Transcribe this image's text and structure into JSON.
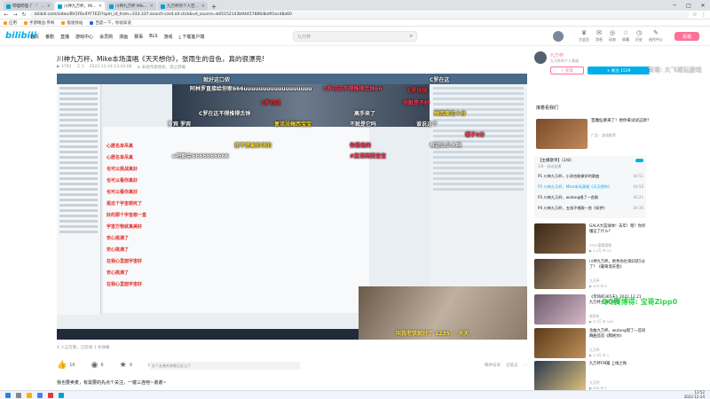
{
  "browser": {
    "tabs": [
      {
        "title": "哔哩哔哩 (゜-゜)つロ 干杯~-bilibili",
        "active": false
      },
      {
        "title": "川神九万杯，Mike本场演唱《天天想你》",
        "active": true
      },
      {
        "title": "川神九万杯 Mike本场演唱",
        "active": false
      },
      {
        "title": "九万杯的个人空间-哔哩哔哩",
        "active": false
      }
    ],
    "url": "bilibili.com/video/BV1F6v4YF7EZ/?spm_id_from=333.337.search-card.all.click&vd_source=b05152143b94457886dbd91ecd8a60",
    "bookmarks": [
      "应用",
      "手游精品·传奇",
      "极速找站",
      "百度一下，你就知道"
    ]
  },
  "header": {
    "logo": "bilibili",
    "nav": [
      "首页",
      "番剧",
      "直播",
      "游戏中心",
      "会员购",
      "漫画",
      "赛事",
      "BLS",
      "游戏",
      "下载客户端"
    ],
    "search_placeholder": "九万杯",
    "icons": [
      {
        "label": "大会员",
        "icon": "vip-icon"
      },
      {
        "label": "消息",
        "icon": "message-icon"
      },
      {
        "label": "动态",
        "icon": "dynamic-icon"
      },
      {
        "label": "收藏",
        "icon": "favorite-icon"
      },
      {
        "label": "历史",
        "icon": "history-icon"
      },
      {
        "label": "创作中心",
        "icon": "creator-icon"
      }
    ],
    "upload_label": "投稿"
  },
  "video": {
    "title": "川神九万杯，Mike本场演唱《天天想你》，张雨生的音色，真的很漂亮!",
    "meta": [
      "▶ 3792",
      "☰ 1",
      "2022-12-24 13:44:08",
      "⊘ 未经作者授权，禁止转载"
    ],
    "danmaku_info": "4 人正在看，已装填 1 条弹幕",
    "actions": [
      {
        "icon": "like-icon",
        "count": "16"
      },
      {
        "icon": "coin-icon",
        "count": "6"
      },
      {
        "icon": "collect-icon",
        "count": "9"
      },
      {
        "icon": "share-icon",
        "count": "15"
      }
    ],
    "danmaku_placeholder": "发个友善的弹幕见证当下",
    "report_label": "稿件投诉",
    "note_label": "记笔记",
    "description": "我也要卖麦，有需要的先点个关注，一键三连吧~谢谢~",
    "danmaku": [
      {
        "text": "就好这口侬",
        "color": "#ffffff"
      },
      {
        "text": "阿林罗直接给你家666uuuuuuuuuuuuuuuuuu",
        "color": "#ffffff"
      },
      {
        "text": "C罗在这不得推得舌钟66",
        "color": "#ff4060"
      },
      {
        "text": "C罗在这",
        "color": "#ffffff"
      },
      {
        "text": "C罗技技",
        "color": "#ff3030"
      },
      {
        "text": "高手来了",
        "color": "#ffffff"
      },
      {
        "text": "罗宾 罗宾",
        "color": "#ffffff"
      },
      {
        "text": "复活没梅西宝宝",
        "color": "#ffe030"
      },
      {
        "text": "不就是它吗",
        "color": "#ffffff"
      },
      {
        "text": "C罗在这",
        "color": "#ff3030"
      },
      {
        "text": "梅西拿走十分",
        "color": "#ffe030"
      },
      {
        "text": "C罗在这不得推得舌钟",
        "color": "#ffffff"
      },
      {
        "text": "你就是不好",
        "color": "#ff4060"
      },
      {
        "text": "谁说这个",
        "color": "#ffffff"
      },
      {
        "text": "帽子9分",
        "color": "#ff4060"
      },
      {
        "text": "还不是被你哄的",
        "color": "#ffe030"
      },
      {
        "text": "你是他的",
        "color": "#ff4060"
      },
      {
        "text": "有这么少人吗",
        "color": "#ffffff"
      },
      {
        "text": "#复活梅西宝宝",
        "color": "#ff4060"
      },
      {
        "text": "e吧那会6666666666",
        "color": "#ffffff"
      }
    ],
    "chat_lines": [
      "心愿名单吊真",
      "心愿名单吊真",
      "也可以挑战真好",
      "也可以看你真好",
      "也可以看你真好",
      "是这个宇宙想死了",
      "好的那个宇宙想一直",
      "宇宙万物就真美好",
      "安心挑满了",
      "安心挑满了",
      "在我心里面宇宙好",
      "安心挑满了",
      "在我心里面宇宙好"
    ],
    "webcam_caption": "叫我老铁就好了 1235 ☆ 天天"
  },
  "up": {
    "name": "九万杯",
    "sign": "九万杯的个人频道",
    "charge_label": "⚡ 充电",
    "follow_label": "+ 关注 1539"
  },
  "ad": {
    "header": "接着看我们",
    "title": "芸魔仙要来了！想你来试试这款？",
    "sub": "广告 · 游戏推荐"
  },
  "playlist": {
    "title": "【主播歌单】(2/8)",
    "sub": "2/8 · 自动连播",
    "items": [
      {
        "title": "P1 川神九万杯，小孩也能做好的歌曲",
        "duration": "04:51",
        "current": false
      },
      {
        "title": "P2 川神九万杯，Mike本场演唱《天天想你》",
        "duration": "04:56",
        "current": true
      },
      {
        "title": "P3 川神九万杯，wutong唱了一首歌",
        "duration": "05:21",
        "current": false
      },
      {
        "title": "P4 川神九万杯，五线子唱歌一首《如梦》",
        "duration": "04:36",
        "current": false
      }
    ]
  },
  "recommendations": [
    {
      "title": "GALA大篮球体！去年！嗯？你听懂这了什么?",
      "up": "3321爱看视频",
      "views": "▶ 1.2万  ☰ 11",
      "color1": "#3a2a1a",
      "color2": "#8a6a4a"
    },
    {
      "title": "川神九万杯。绝色你也来好跃5分了？《葡萄酒天使》",
      "up": "九万杯",
      "views": "▶ 470  ☰ 0",
      "color1": "#4a3a2a",
      "color2": "#b89a7a"
    },
    {
      "title": "《李琦的365天》2022.12.21 九万杯主播在哪里",
      "up": "张四木",
      "views": "▶ 3.7万  ☰ 120",
      "color1": "#6a5a6a",
      "color2": "#d8b8c8"
    },
    {
      "title": "金曲九万杯。wutong唱了一首同舞曲首首《腾格尔》",
      "up": "九万杯",
      "views": "▶ 1.3万  ☰ 1",
      "color1": "#5a3a1a",
      "color2": "#c0905a"
    },
    {
      "title": "九万杯FM篇 上线之殇",
      "up": "九万杯",
      "views": "▶ 540  ☰ 2",
      "color1": "#2a3a4a",
      "color2": "#e0c080"
    },
    {
      "title": "川神九万杯深夜篇，老黄印《天天想你》，张雨生金曲",
      "up": "九万杯",
      "views": "▶ 1.1万  ☰ 4",
      "color1": "#8a7a6a",
      "color2": "#e8e0d0"
    }
  ],
  "watermarks": {
    "qq": "QQ赛博得: 宝哥Zipp0",
    "top": "宝哥: 大飞哥玩游戏"
  },
  "taskbar": {
    "time": "13:52",
    "date": "2022-12-24"
  }
}
